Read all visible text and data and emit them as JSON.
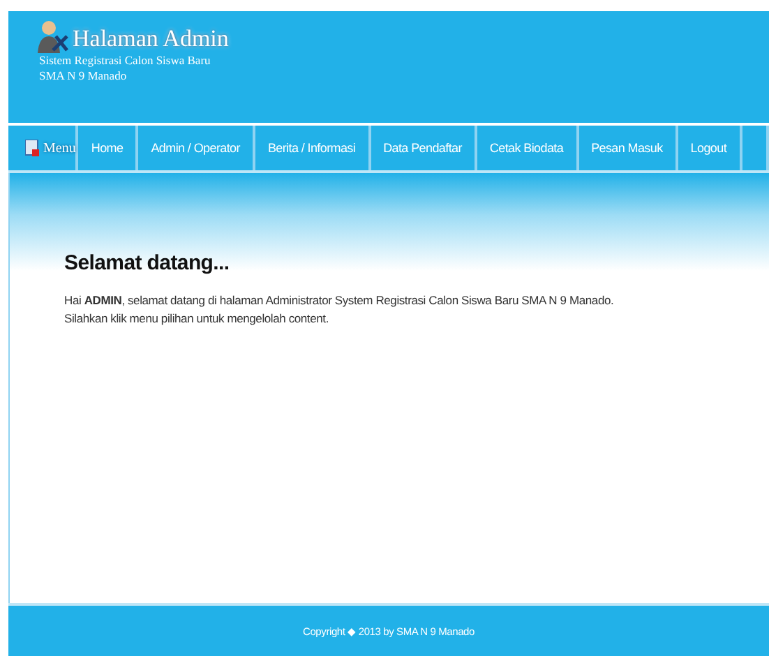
{
  "header": {
    "title": "Halaman Admin",
    "subtitle_lines": [
      "Sistem Registrasi Calon Siswa Baru",
      "SMA N 9 Manado"
    ]
  },
  "nav": {
    "menu_label": "Menu",
    "items": [
      {
        "label": "Home"
      },
      {
        "label": "Admin / Operator"
      },
      {
        "label": "Berita / Informasi"
      },
      {
        "label": "Data Pendaftar"
      },
      {
        "label": "Cetak Biodata"
      },
      {
        "label": "Pesan Masuk"
      },
      {
        "label": "Logout"
      }
    ]
  },
  "content": {
    "heading": "Selamat datang...",
    "paragraphs": [
      "Hai **ADMIN**, selamat datang di halaman Administrator System Registrasi Calon Siswa Baru SMA N 9 Manado.",
      "Silahkan klik menu pilihan untuk mengelolah content."
    ]
  },
  "footer": {
    "text": "Copyright ◆ 2013 by SMA N 9 Manado"
  }
}
